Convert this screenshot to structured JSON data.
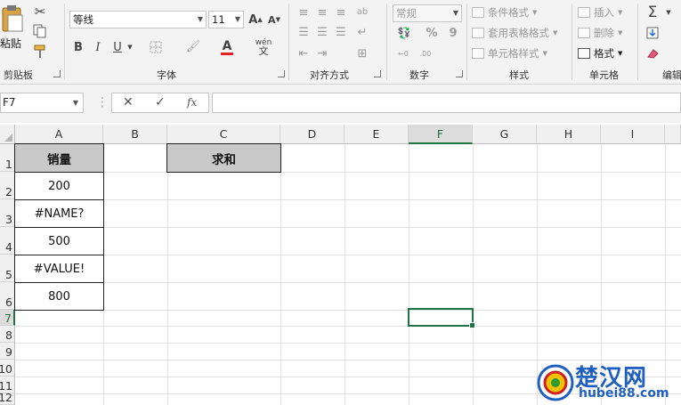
{
  "ribbon": {
    "clipboard": {
      "paste": "粘贴",
      "label": "剪贴板"
    },
    "font": {
      "name": "等线",
      "size": "11",
      "bold": "B",
      "italic": "I",
      "underline": "U",
      "label": "字体",
      "phonetic": "wén"
    },
    "alignment": {
      "label": "对齐方式"
    },
    "number": {
      "format": "常规",
      "percent": "%",
      "comma": "9",
      "label": "数字"
    },
    "styles": {
      "conditional": "条件格式",
      "table": "套用表格格式",
      "cell_styles": "单元格样式",
      "label": "样式"
    },
    "cells": {
      "insert": "插入",
      "delete": "删除",
      "format": "格式",
      "label": "单元格"
    },
    "editing": {
      "sum": "Σ",
      "label": "编辑"
    }
  },
  "formula_bar": {
    "name_box": "F7",
    "cancel": "✕",
    "enter": "✓",
    "fx": "fx",
    "formula": ""
  },
  "columns": [
    "A",
    "B",
    "C",
    "D",
    "E",
    "F",
    "G",
    "H",
    "I"
  ],
  "rows": [
    "1",
    "2",
    "3",
    "4",
    "5",
    "6",
    "7",
    "8",
    "9",
    "10",
    "11",
    "12"
  ],
  "selected_cell": {
    "column": "F",
    "row": "7"
  },
  "cells": {
    "A1": "销量",
    "A2": "200",
    "A3": "#NAME?",
    "A4": "500",
    "A5": "#VALUE!",
    "A6": "800",
    "C1": "求和"
  },
  "watermark": {
    "title": "楚汉网",
    "url": "hubei88.com"
  },
  "colors": {
    "accent": "#217346",
    "header_fill": "#c9c9c9",
    "watermark": "#1f5fbf"
  }
}
